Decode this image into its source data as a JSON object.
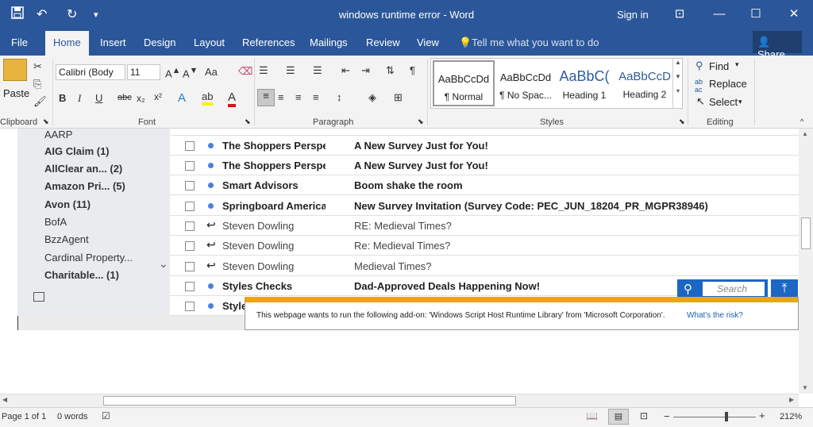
{
  "window": {
    "title": "windows runtime error - Word",
    "signin": "Sign in",
    "share": "Share"
  },
  "quick_access": {
    "save_icon": "save-icon",
    "undo_icon": "undo-icon",
    "redo_icon": "redo-icon",
    "customize": "▾"
  },
  "tabs": [
    {
      "label": "File"
    },
    {
      "label": "Home"
    },
    {
      "label": "Insert"
    },
    {
      "label": "Design"
    },
    {
      "label": "Layout"
    },
    {
      "label": "References"
    },
    {
      "label": "Mailings"
    },
    {
      "label": "Review"
    },
    {
      "label": "View"
    },
    {
      "label": "Tell me what you want to do"
    }
  ],
  "ribbon": {
    "clipboard": {
      "paste": "Paste",
      "label": "Clipboard"
    },
    "font": {
      "name": "Calibri (Body",
      "size": "11",
      "label": "Font",
      "case": "Aa"
    },
    "paragraph": {
      "label": "Paragraph"
    },
    "styles": {
      "label": "Styles",
      "items": [
        {
          "preview": "AaBbCcDd",
          "name": "¶ Normal"
        },
        {
          "preview": "AaBbCcDd",
          "name": "¶ No Spac..."
        },
        {
          "preview": "AaBbC(",
          "name": "Heading 1"
        },
        {
          "preview": "AaBbCcD",
          "name": "Heading 2"
        }
      ]
    },
    "editing": {
      "find": "Find",
      "replace": "Replace",
      "select": "Select",
      "label": "Editing"
    }
  },
  "left_pane": {
    "items": [
      {
        "label": "AARP",
        "bold": false
      },
      {
        "label": "AIG Claim  (1)",
        "bold": true
      },
      {
        "label": "AllClear an...   (2)",
        "bold": true
      },
      {
        "label": "Amazon Pri...  (5)",
        "bold": true
      },
      {
        "label": "Avon  (11)",
        "bold": true
      },
      {
        "label": "BofA",
        "bold": false
      },
      {
        "label": "BzzAgent",
        "bold": false
      },
      {
        "label": "Cardinal Property...",
        "bold": false
      },
      {
        "label": "Charitable...      (1)",
        "bold": true
      }
    ]
  },
  "emails": [
    {
      "from": "The Shoppers Perspe",
      "subject": "A New Survey Just for You!",
      "unread": true
    },
    {
      "from": "The Shoppers Perspe",
      "subject": "A New Survey Just for You!",
      "unread": true
    },
    {
      "from": "Smart Advisors",
      "subject": "Boom shake the room",
      "unread": true
    },
    {
      "from": "Springboard America",
      "subject": "New Survey Invitation (Survey Code: PEC_JUN_18204_PR_MGPR38946)",
      "unread": true
    },
    {
      "from": "Steven Dowling",
      "subject": "RE: Medieval Times?",
      "unread": false
    },
    {
      "from": "Steven Dowling",
      "subject": "Re: Medieval Times?",
      "unread": false
    },
    {
      "from": "Steven Dowling",
      "subject": "Medieval Times?",
      "unread": false
    },
    {
      "from": "Styles Checks",
      "subject": "Dad-Approved Deals Happening Now!",
      "unread": true
    },
    {
      "from": "Style",
      "subject": "",
      "unread": true
    }
  ],
  "search": {
    "placeholder": "Search"
  },
  "notification": {
    "message": "This webpage wants to run the following add-on: 'Windows Script Host Runtime Library' from 'Microsoft Corporation'.",
    "link": "What's the risk?"
  },
  "status": {
    "page": "Page 1 of 1",
    "words": "0 words",
    "zoom": "212%"
  },
  "colors": {
    "brand": "#2b579a",
    "accent": "#f0a30a"
  }
}
